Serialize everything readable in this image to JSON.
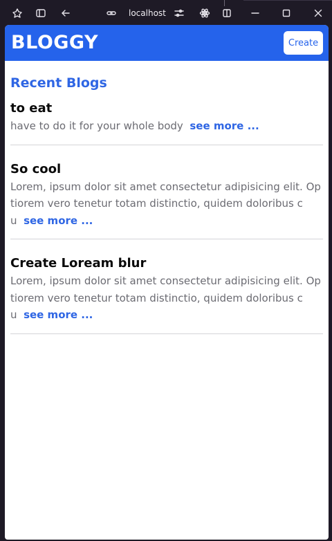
{
  "browser": {
    "url": "localhost"
  },
  "app": {
    "brand": "BLOGGY",
    "create_label": "Create"
  },
  "main": {
    "section_title": "Recent Blogs",
    "see_more_label": "see more ...",
    "posts": [
      {
        "title": "to eat",
        "body": "have to do it for your whole body"
      },
      {
        "title": "So cool",
        "body": "Lorem, ipsum dolor sit amet consectetur adipisicing elit. Optiorem vero tenetur totam distinctio, quidem doloribus cu"
      },
      {
        "title": "Create Loream blur",
        "body": "Lorem, ipsum dolor sit amet consectetur adipisicing elit. Optiorem vero tenetur totam distinctio, quidem doloribus cu"
      }
    ]
  },
  "colors": {
    "primary": "#2563eb",
    "link": "#2f66e4",
    "chrome_bg": "#1e1a26"
  }
}
